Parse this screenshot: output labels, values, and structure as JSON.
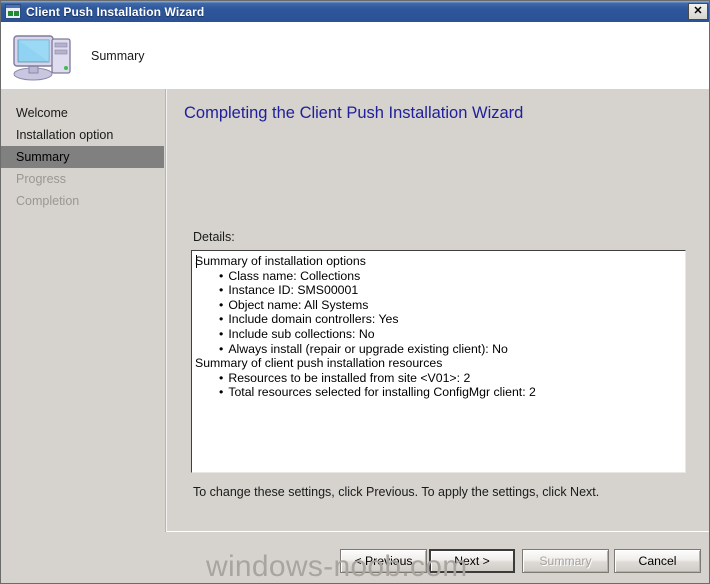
{
  "window": {
    "title": "Client Push Installation Wizard",
    "icon": "wizard-window-icon",
    "close_label": "✕"
  },
  "header": {
    "caption": "Summary",
    "icon": "computer-icon"
  },
  "sidebar": {
    "items": [
      {
        "label": "Welcome",
        "state": "normal"
      },
      {
        "label": "Installation option",
        "state": "normal"
      },
      {
        "label": "Summary",
        "state": "selected"
      },
      {
        "label": "Progress",
        "state": "disabled"
      },
      {
        "label": "Completion",
        "state": "disabled"
      }
    ]
  },
  "main": {
    "title": "Completing the Client Push Installation Wizard",
    "title_color": "#20209a",
    "details_label": "Details:",
    "details": [
      {
        "text": "Summary of installation options",
        "bullet": false
      },
      {
        "text": "Class name: Collections",
        "bullet": true
      },
      {
        "text": "Instance ID: SMS00001",
        "bullet": true
      },
      {
        "text": "Object name: All Systems",
        "bullet": true
      },
      {
        "text": "Include domain controllers: Yes",
        "bullet": true
      },
      {
        "text": "Include sub collections: No",
        "bullet": true
      },
      {
        "text": "Always install (repair or upgrade existing client): No",
        "bullet": true
      },
      {
        "text": "Summary of client push installation resources",
        "bullet": false
      },
      {
        "text": "Resources to be installed from site <V01>: 2",
        "bullet": true
      },
      {
        "text": "Total resources selected for installing ConfigMgr client:  2",
        "bullet": true
      }
    ],
    "footer_note": "To change these settings, click Previous. To apply the settings, click Next."
  },
  "buttons": {
    "previous": "< Previous",
    "next": "Next >",
    "summary": "Summary",
    "cancel": "Cancel"
  },
  "watermark": {
    "text": "windows-noob.com",
    "color": "#a8a5a0"
  }
}
